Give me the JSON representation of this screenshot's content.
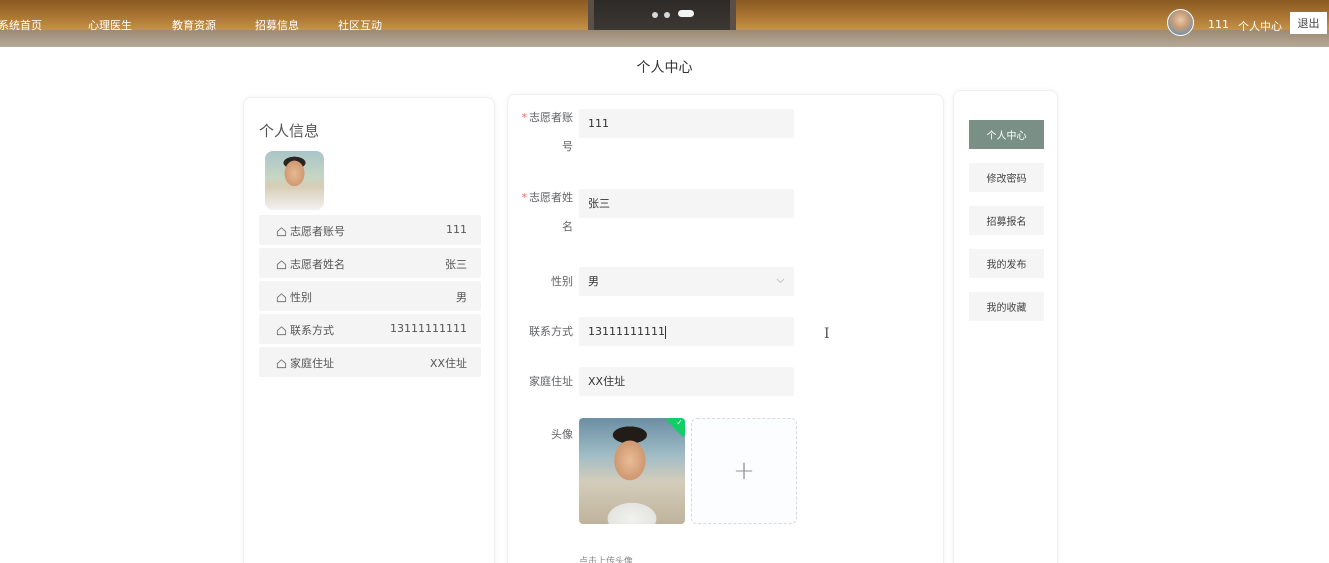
{
  "nav": {
    "items": [
      "系统首页",
      "心理医生",
      "教育资源",
      "招募信息",
      "社区互动"
    ],
    "username": "111",
    "center_link": "个人中心",
    "logout": "退出"
  },
  "page_title": "个人中心",
  "profile": {
    "title": "个人信息",
    "rows": [
      {
        "label": "志愿者账号",
        "value": "111"
      },
      {
        "label": "志愿者姓名",
        "value": "张三"
      },
      {
        "label": "性别",
        "value": "男"
      },
      {
        "label": "联系方式",
        "value": "13111111111"
      },
      {
        "label": "家庭住址",
        "value": "XX住址"
      }
    ],
    "row_icon": "home-outline-icon"
  },
  "form": {
    "account": {
      "label_line1": "志愿者账",
      "label_line2": "号",
      "required_mark": "*",
      "value": "111"
    },
    "name": {
      "label_line1": "志愿者姓",
      "label_line2": "名",
      "required_mark": "*",
      "value": "张三"
    },
    "gender": {
      "label": "性别",
      "value": "男",
      "icon": "chevron-down-icon"
    },
    "phone": {
      "label": "联系方式",
      "value": "13111111111"
    },
    "address": {
      "label": "家庭住址",
      "value": "XX住址"
    },
    "avatar": {
      "label": "头像",
      "add_symbol": "+",
      "success_icon": "check-icon",
      "tip": "点击上传头像"
    }
  },
  "menu": {
    "items": [
      "个人中心",
      "修改密码",
      "招募报名",
      "我的发布",
      "我的收藏"
    ],
    "active_index": 0
  },
  "colors": {
    "menu_active": "#7a8f86",
    "required": "#f56c6c",
    "upload_success": "#13ce66",
    "input_bg": "#f5f5f5"
  }
}
